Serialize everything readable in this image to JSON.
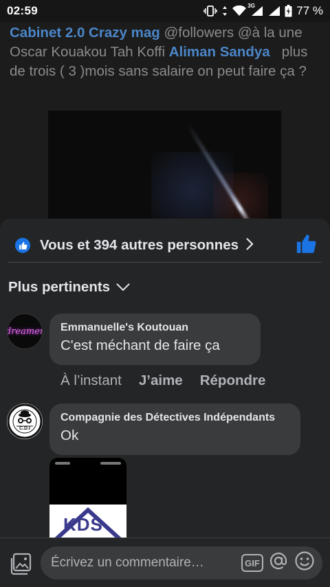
{
  "status_bar": {
    "time": "02:59",
    "battery_percent": "77 %",
    "network": "3G"
  },
  "post": {
    "mention_1": "Cabinet 2.0 Crazy mag",
    "text_1": " @followers @à la une Oscar Kouakou Tah Koffi ",
    "mention_2": "Aliman Sandya",
    "text_2": "   plus de trois ( 3 )mois sans salaire on peut faire ça ?"
  },
  "reactions": {
    "summary": "Vous et 394 autres personnes"
  },
  "sort": {
    "label": "Plus pertinents"
  },
  "comments": [
    {
      "author": "Emmanuelle's Koutouan",
      "avatar_text": "dreamer",
      "text": "C'est méchant de faire ça",
      "time": "À l’instant",
      "like_label": "J’aime",
      "reply_label": "Répondre"
    },
    {
      "author": "Compagnie des Détectives Indépendants",
      "avatar_text": "C.D.I",
      "text": "Ok",
      "attachment_text": "KDS"
    }
  ],
  "composer": {
    "placeholder": "Écrivez un commentaire…",
    "gif_label": "GIF"
  },
  "colors": {
    "accent": "#1b74e4",
    "mention": "#4b86c9",
    "sheet": "#242526",
    "bubble": "#3a3b3c"
  }
}
